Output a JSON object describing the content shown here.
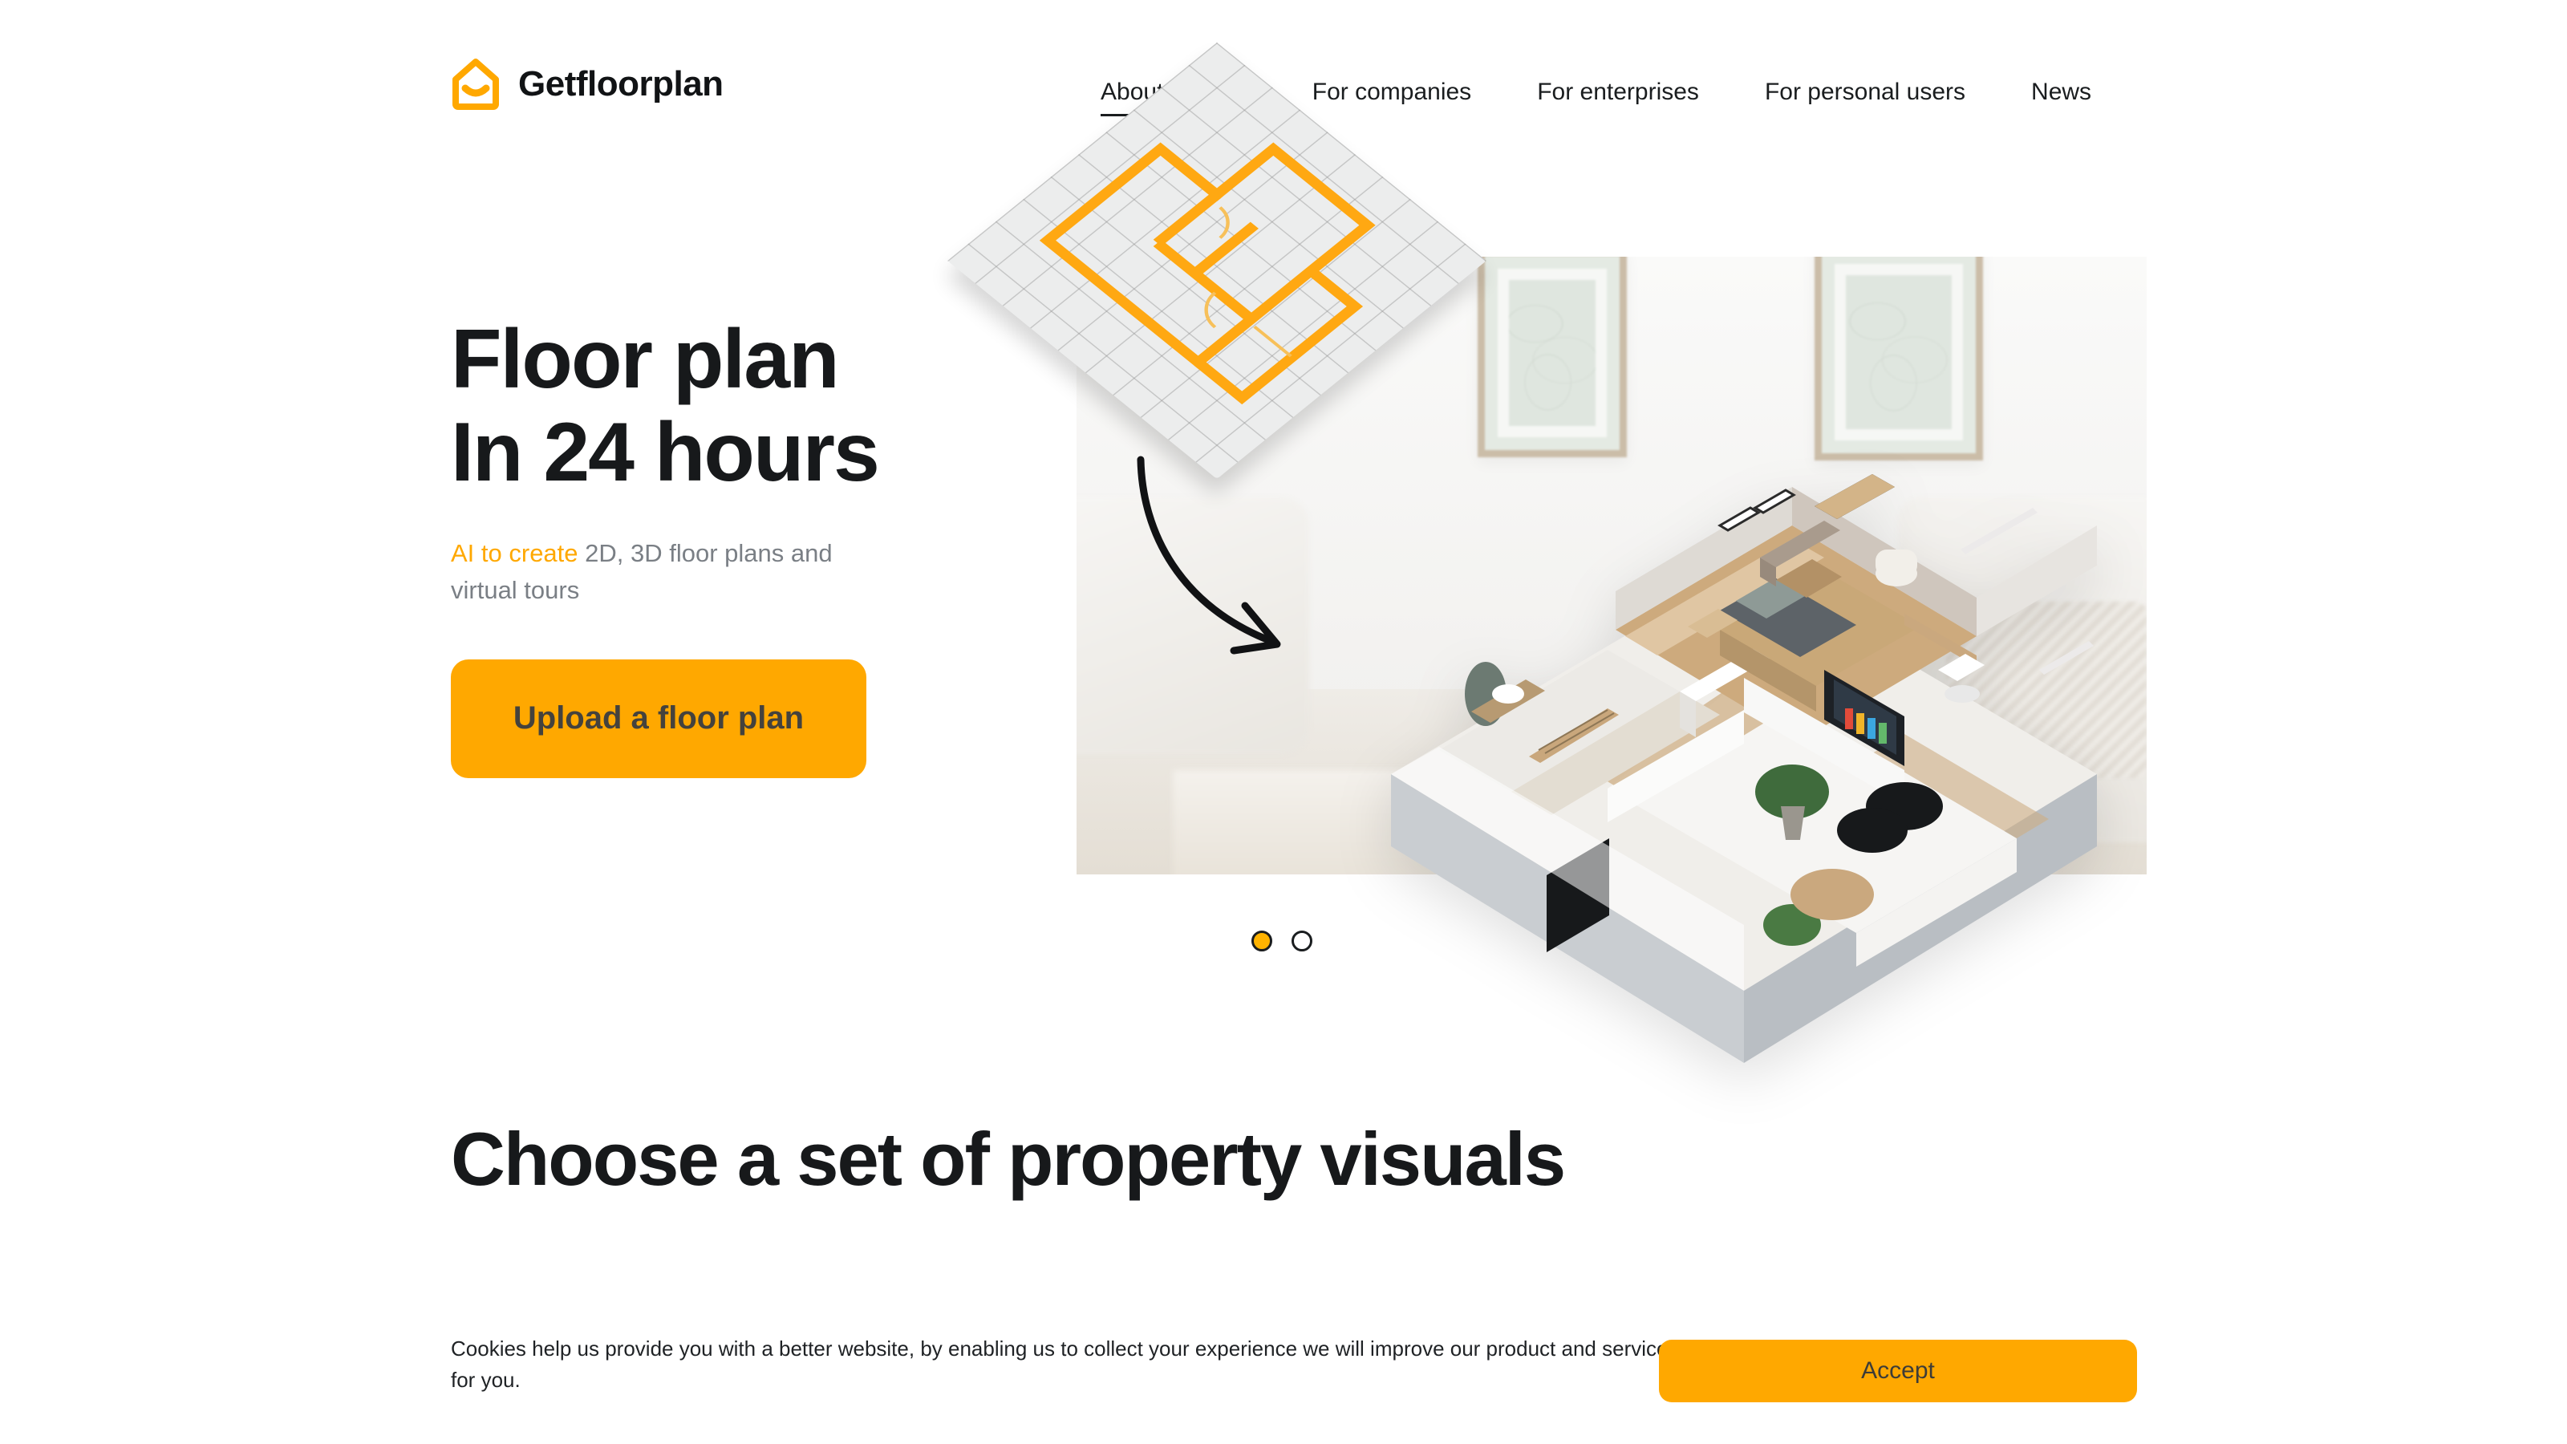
{
  "brand": {
    "name": "Getfloorplan",
    "logo_icon": "house-smile-icon",
    "accent_color": "#FFA800",
    "text_color": "#17191B"
  },
  "nav": {
    "items": [
      {
        "label": "About service",
        "active": true
      },
      {
        "label": "For companies",
        "active": false
      },
      {
        "label": "For enterprises",
        "active": false
      },
      {
        "label": "For personal users",
        "active": false
      },
      {
        "label": "News",
        "active": false
      }
    ]
  },
  "hero": {
    "title_line1": "Floor plan",
    "title_line2": "In 24 hours",
    "subtitle_highlight": "AI to create",
    "subtitle_rest": " 2D, 3D floor plans and virtual tours",
    "cta_label": "Upload a floor plan",
    "media": {
      "plan_sheet_icon": "2d-floor-plan-sheet-icon",
      "arrow_icon": "curved-arrow-icon",
      "model_icon": "3d-apartment-model-icon",
      "background_description": "blurred living room interior with framed art"
    }
  },
  "carousel": {
    "dots": [
      {
        "index": 1,
        "active": true
      },
      {
        "index": 2,
        "active": false
      }
    ]
  },
  "section": {
    "heading": "Choose a set of property visuals"
  },
  "cookie_banner": {
    "message": "Cookies help us provide you with a better website, by enabling us to collect your experience we will improve our product and services for you.",
    "accept_label": "Accept"
  }
}
